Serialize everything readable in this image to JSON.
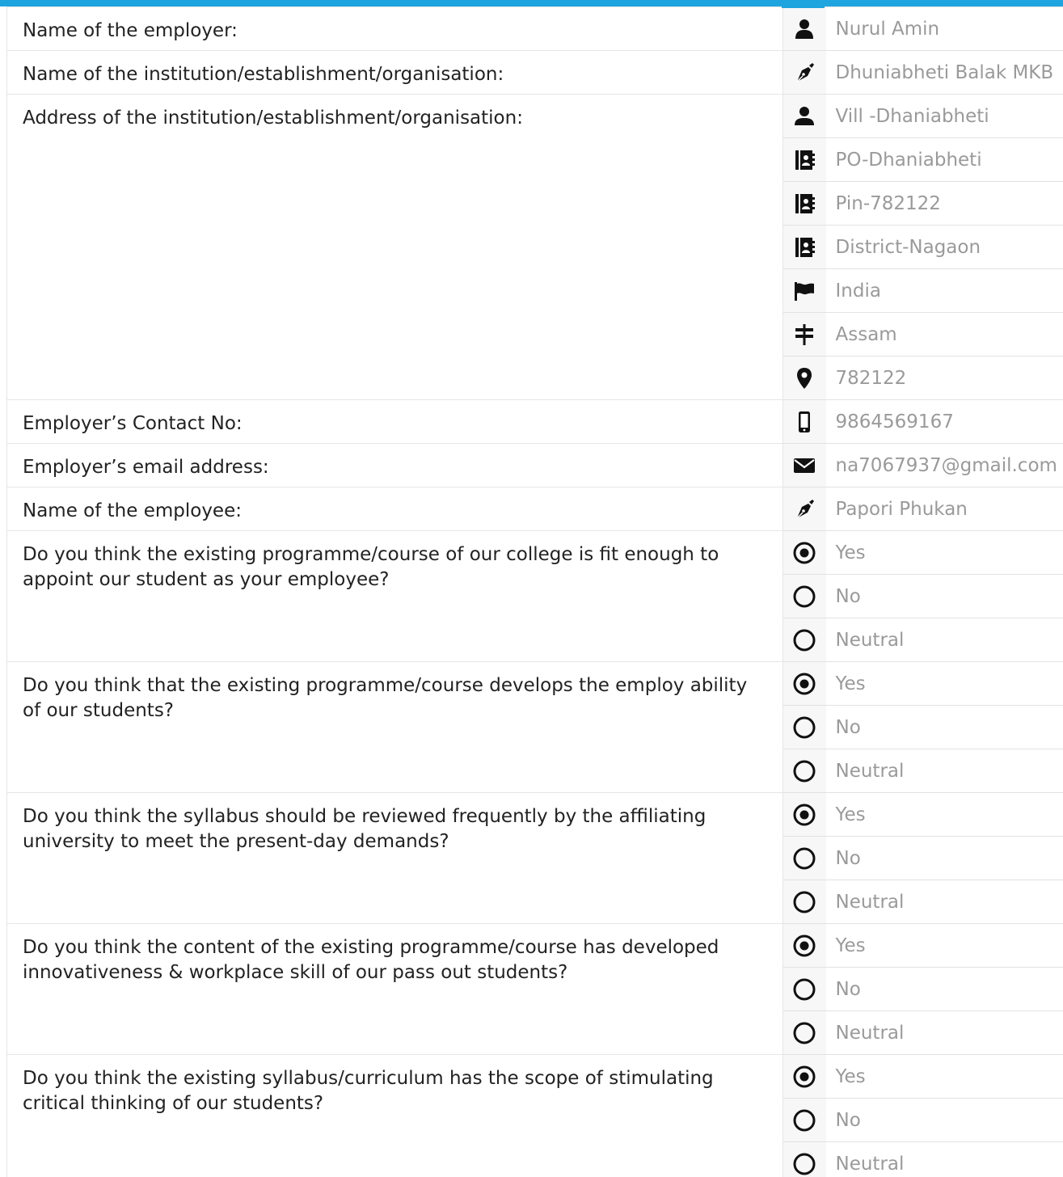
{
  "form": {
    "employer_label": "Name of the employer:",
    "employer_value": "Nurul Amin",
    "institution_label": "Name of the institution/establishment/organisation:",
    "institution_value": "Dhuniabheti Balak MKB",
    "address_label": "Address of the institution/establishment/organisation:",
    "address": {
      "line1": "Vill -Dhaniabheti",
      "line2": "PO-Dhaniabheti",
      "line3": "Pin-782122",
      "line4": "District-Nagaon",
      "country": "India",
      "state": "Assam",
      "zip": "782122"
    },
    "contact_label": "Employer’s Contact No:",
    "contact_value": "9864569167",
    "email_label": "Employer’s email address:",
    "email_value": "na7067937@gmail.com",
    "employee_label": "Name of the employee:",
    "employee_value": "Papori Phukan"
  },
  "questions": [
    {
      "text": "Do you think the existing programme/course of our college is fit enough to appoint our student as your employee?",
      "options": [
        "Yes",
        "No",
        "Neutral"
      ],
      "selected": "Yes"
    },
    {
      "text": "Do you think that the existing programme/course develops the employ ability of our students?",
      "options": [
        "Yes",
        "No",
        "Neutral"
      ],
      "selected": "Yes"
    },
    {
      "text": "Do you think the syllabus should be reviewed frequently by the affiliating university to meet the present-day demands?",
      "options": [
        "Yes",
        "No",
        "Neutral"
      ],
      "selected": "Yes"
    },
    {
      "text": "Do you think the content of the existing programme/course has developed innovativeness & workplace skill of our pass out students?",
      "options": [
        "Yes",
        "No",
        "Neutral"
      ],
      "selected": "Yes"
    },
    {
      "text": "Do you think the existing syllabus/curriculum has the scope of stimulating critical thinking of our students?",
      "options": [
        "Yes",
        "No",
        "Neutral"
      ],
      "selected": "Yes"
    }
  ],
  "colors": {
    "accent": "#1ea4de",
    "label_text": "#222222",
    "value_text": "#9a9a9a",
    "icon": "#111111"
  },
  "icons": {
    "employer": "user-icon",
    "institution": "pen-nib-icon",
    "address_line": "user-icon",
    "address_book": "address-book-icon",
    "country": "flag-icon",
    "state": "signpost-icon",
    "zip": "map-marker-icon",
    "contact": "mobile-phone-icon",
    "email": "envelope-icon",
    "employee": "pen-nib-icon",
    "radio_checked": "radio-checked-icon",
    "radio_unchecked": "radio-unchecked-icon"
  }
}
